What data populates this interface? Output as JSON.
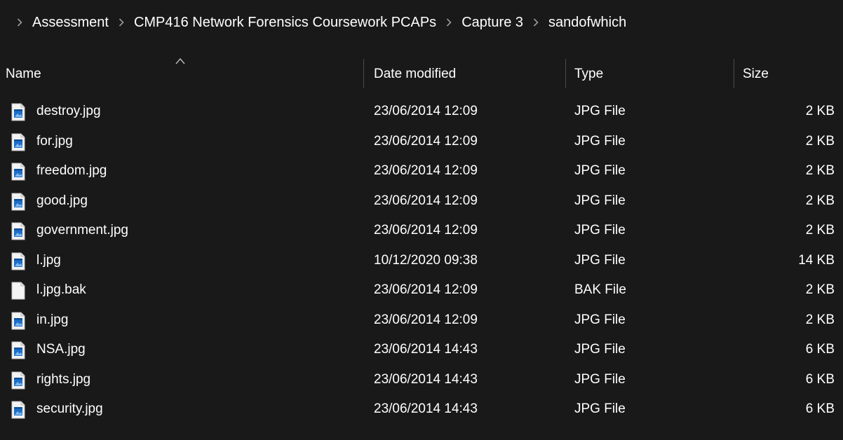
{
  "breadcrumb": {
    "items": [
      "Assessment",
      "CMP416 Network Forensics Coursework PCAPs",
      "Capture 3",
      "sandofwhich"
    ]
  },
  "columns": {
    "name": "Name",
    "date": "Date modified",
    "type": "Type",
    "size": "Size"
  },
  "files": [
    {
      "name": "destroy.jpg",
      "date": "23/06/2014 12:09",
      "type": "JPG File",
      "size": "2 KB",
      "icon": "image-file-icon"
    },
    {
      "name": "for.jpg",
      "date": "23/06/2014 12:09",
      "type": "JPG File",
      "size": "2 KB",
      "icon": "image-file-icon"
    },
    {
      "name": "freedom.jpg",
      "date": "23/06/2014 12:09",
      "type": "JPG File",
      "size": "2 KB",
      "icon": "image-file-icon"
    },
    {
      "name": "good.jpg",
      "date": "23/06/2014 12:09",
      "type": "JPG File",
      "size": "2 KB",
      "icon": "image-file-icon"
    },
    {
      "name": "government.jpg",
      "date": "23/06/2014 12:09",
      "type": "JPG File",
      "size": "2 KB",
      "icon": "image-file-icon"
    },
    {
      "name": "l.jpg",
      "date": "10/12/2020 09:38",
      "type": "JPG File",
      "size": "14 KB",
      "icon": "image-file-icon"
    },
    {
      "name": "l.jpg.bak",
      "date": "23/06/2014 12:09",
      "type": "BAK File",
      "size": "2 KB",
      "icon": "blank-file-icon"
    },
    {
      "name": "in.jpg",
      "date": "23/06/2014 12:09",
      "type": "JPG File",
      "size": "2 KB",
      "icon": "image-file-icon"
    },
    {
      "name": "NSA.jpg",
      "date": "23/06/2014 14:43",
      "type": "JPG File",
      "size": "6 KB",
      "icon": "image-file-icon"
    },
    {
      "name": "rights.jpg",
      "date": "23/06/2014 14:43",
      "type": "JPG File",
      "size": "6 KB",
      "icon": "image-file-icon"
    },
    {
      "name": "security.jpg",
      "date": "23/06/2014 14:43",
      "type": "JPG File",
      "size": "6 KB",
      "icon": "image-file-icon"
    }
  ],
  "colors": {
    "background": "#191919",
    "text": "#ffffff",
    "separator": "#9a9a9a",
    "icon_blue": "#1e6fc8"
  }
}
